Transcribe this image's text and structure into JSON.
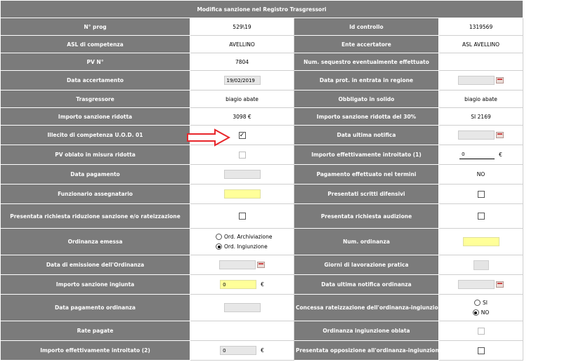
{
  "title": "Modifica sanzione nel Registro Trasgressori",
  "rows": [
    {
      "l1": "N° prog",
      "v1": "529\\19",
      "l2": "Id controllo",
      "v2": "1319569"
    },
    {
      "l1": "ASL di competenza",
      "v1": "AVELLINO",
      "l2": "Ente accertatore",
      "v2": "ASL AVELLINO"
    },
    {
      "l1": "PV N°",
      "v1": "7804",
      "l2": "Num. sequestro eventualmente effettuato",
      "v2": ""
    },
    {
      "l1": "Data accertamento",
      "v1": "19/02/2019",
      "l2": "Data prot. in entrata in regione",
      "v2": ""
    },
    {
      "l1": "Trasgressore",
      "v1": "biagio abate",
      "l2": "Obbligato in solido",
      "v2": "biagio abate"
    },
    {
      "l1": "Importo sanzione ridotta",
      "v1": "3098 €",
      "l2": "Importo sanzione ridotta del 30%",
      "v2": "SI 2169"
    },
    {
      "l1": "Illecito di competenza U.O.D. 01",
      "v1": "",
      "l2": "Data ultima notifica",
      "v2": ""
    },
    {
      "l1": "PV oblato in misura ridotta",
      "v1": "",
      "l2": "Importo effettivamente introitato (1)",
      "v2": "0"
    },
    {
      "l1": "Data pagamento",
      "v1": "",
      "l2": "Pagamento effettuato nei termini",
      "v2": "NO"
    },
    {
      "l1": "Funzionario assegnatario",
      "v1": "",
      "l2": "Presentati scritti difensivi",
      "v2": ""
    },
    {
      "l1": "Presentata richiesta riduzione sanzione e/o rateizzazione",
      "v1": "",
      "l2": "Presentata richiesta audizione",
      "v2": ""
    },
    {
      "l1": "Ordinanza emessa",
      "v1": "",
      "l2": "Num. ordinanza",
      "v2": ""
    },
    {
      "l1": "Data di emissione dell'Ordinanza",
      "v1": "",
      "l2": "Giorni di lavorazione pratica",
      "v2": ""
    },
    {
      "l1": "Importo sanzione ingiunta",
      "v1": "0",
      "l2": "Data ultima notifica ordinanza",
      "v2": ""
    },
    {
      "l1": "Data pagamento ordinanza",
      "v1": "",
      "l2": "Concessa rateizzazione dell'ordinanza-ingiunzione",
      "v2": ""
    },
    {
      "l1": "Rate pagate",
      "v1": "",
      "l2": "Ordinanza ingiunzione oblata",
      "v2": ""
    },
    {
      "l1": "Importo effettivamente introitato (2)",
      "v1": "0",
      "l2": "Presentata opposizione all'ordinanza-ingiunzione",
      "v2": ""
    }
  ],
  "currency": "€",
  "check_mark": "✓",
  "ordinanza_options": [
    "Ord. Archiviazione",
    "Ord. Ingiunzione"
  ],
  "rateizzazione_options": [
    "SI",
    "NO"
  ],
  "colors": {
    "header": "#7b7b7b",
    "highlight": "#ffff99",
    "arrow": "#e8262b"
  }
}
